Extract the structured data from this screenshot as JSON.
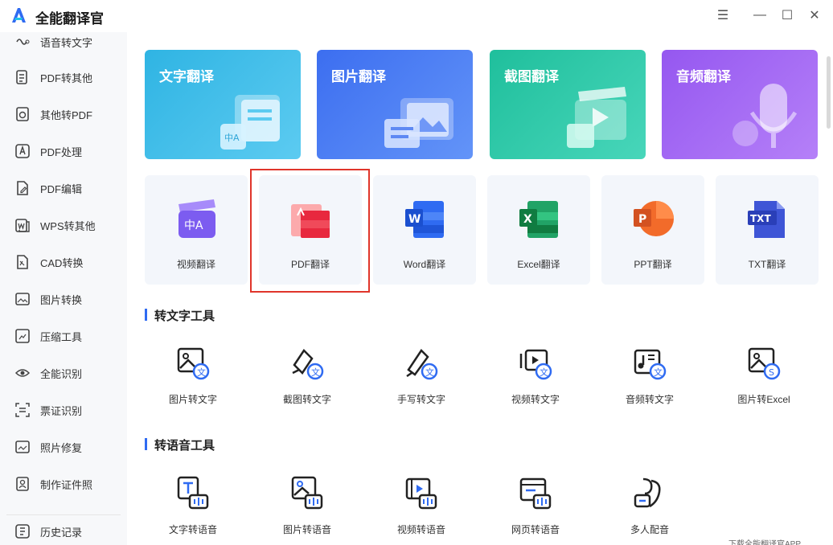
{
  "app": {
    "title": "全能翻译官"
  },
  "window_controls": {
    "menu": "☰",
    "minimize": "—",
    "maximize": "☐",
    "close": "✕"
  },
  "sidebar": {
    "items": [
      {
        "label": "语音转文字",
        "icon": "audio-wave-icon"
      },
      {
        "label": "PDF转其他",
        "icon": "pdf-convert-icon"
      },
      {
        "label": "其他转PDF",
        "icon": "to-pdf-icon"
      },
      {
        "label": "PDF处理",
        "icon": "pdf-process-icon"
      },
      {
        "label": "PDF编辑",
        "icon": "pdf-edit-icon"
      },
      {
        "label": "WPS转其他",
        "icon": "wps-convert-icon"
      },
      {
        "label": "CAD转换",
        "icon": "cad-convert-icon"
      },
      {
        "label": "图片转换",
        "icon": "image-convert-icon"
      },
      {
        "label": "压缩工具",
        "icon": "compress-icon"
      },
      {
        "label": "全能识别",
        "icon": "eye-scan-icon"
      },
      {
        "label": "票证识别",
        "icon": "ticket-scan-icon"
      },
      {
        "label": "照片修复",
        "icon": "photo-repair-icon"
      },
      {
        "label": "制作证件照",
        "icon": "id-photo-icon"
      },
      {
        "label": "历史记录",
        "icon": "history-icon"
      }
    ]
  },
  "translate_cards": [
    {
      "label": "文字翻译",
      "color_from": "#34b9e6",
      "color_to": "#4fc6ef"
    },
    {
      "label": "图片翻译",
      "color_from": "#3f73f2",
      "color_to": "#5b8ff7"
    },
    {
      "label": "截图翻译",
      "color_from": "#25c3a1",
      "color_to": "#3fd2b5"
    },
    {
      "label": "音频翻译",
      "color_from": "#9b5cf2",
      "color_to": "#b47ef7"
    }
  ],
  "doc_tiles": [
    {
      "label": "视频翻译",
      "icon": "video-translate-icon"
    },
    {
      "label": "PDF翻译",
      "icon": "pdf-icon",
      "highlighted": true
    },
    {
      "label": "Word翻译",
      "icon": "word-icon"
    },
    {
      "label": "Excel翻译",
      "icon": "excel-icon"
    },
    {
      "label": "PPT翻译",
      "icon": "ppt-icon"
    },
    {
      "label": "TXT翻译",
      "icon": "txt-icon"
    }
  ],
  "text_tools": {
    "title": "转文字工具",
    "items": [
      {
        "label": "图片转文字",
        "icon": "image-to-text-icon"
      },
      {
        "label": "截图转文字",
        "icon": "screenshot-to-text-icon"
      },
      {
        "label": "手写转文字",
        "icon": "handwriting-to-text-icon"
      },
      {
        "label": "视频转文字",
        "icon": "video-to-text-icon"
      },
      {
        "label": "音频转文字",
        "icon": "audio-to-text-icon"
      },
      {
        "label": "图片转Excel",
        "icon": "image-to-excel-icon"
      }
    ]
  },
  "voice_tools": {
    "title": "转语音工具",
    "items": [
      {
        "label": "文字转语音",
        "icon": "text-to-speech-icon"
      },
      {
        "label": "图片转语音",
        "icon": "image-to-speech-icon"
      },
      {
        "label": "视频转语音",
        "icon": "video-to-speech-icon"
      },
      {
        "label": "网页转语音",
        "icon": "webpage-to-speech-icon"
      },
      {
        "label": "多人配音",
        "icon": "multi-voice-icon"
      }
    ]
  },
  "footer": {
    "text": "下载全能翻译官APP"
  },
  "colors": {
    "accent": "#2f6bf2",
    "highlight": "#e0352b"
  }
}
